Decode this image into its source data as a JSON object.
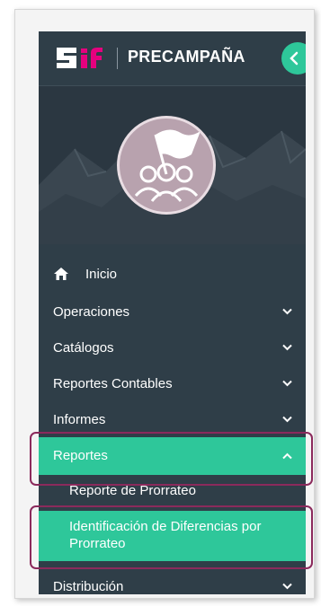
{
  "header": {
    "logo_text": "SIF",
    "title": "PRECAMPAÑA",
    "collapse_icon": "chevron-left-icon"
  },
  "banner": {
    "avatar_icon": "flag-group-icon"
  },
  "menu": {
    "home": {
      "label": "Inicio",
      "icon": "home-icon"
    },
    "items": [
      {
        "label": "Operaciones",
        "icon": "chevron-down-icon"
      },
      {
        "label": "Catálogos",
        "icon": "chevron-down-icon"
      },
      {
        "label": "Reportes Contables",
        "icon": "chevron-down-icon"
      },
      {
        "label": "Informes",
        "icon": "chevron-down-icon"
      },
      {
        "label": "Reportes",
        "icon": "chevron-up-icon"
      },
      {
        "label": "Distribución",
        "icon": "chevron-down-icon"
      }
    ],
    "submenu": [
      {
        "label": "Reporte de Prorrateo"
      },
      {
        "label_line1": "Identificación de Diferencias por",
        "label_line2": "Prorrateo"
      }
    ]
  },
  "colors": {
    "sidebar_bg": "#2f3e48",
    "accent": "#2ec79a",
    "highlight_border": "#8b2a5c",
    "logo_pink": "#e5007e"
  }
}
